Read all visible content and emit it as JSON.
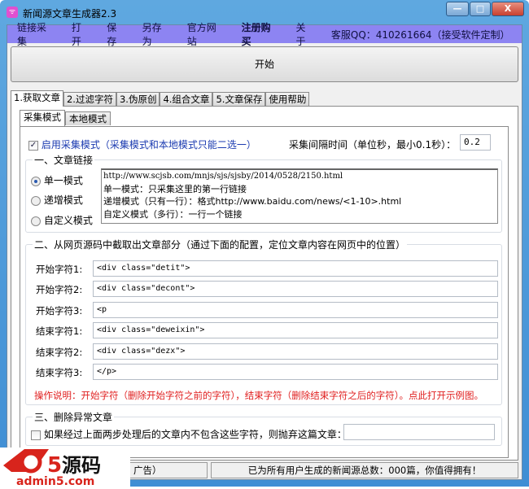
{
  "window": {
    "title": "新闻源文章生成器2.3",
    "minimize": "—",
    "maximize": "□",
    "close": "X"
  },
  "menu": [
    "链接采集",
    "打开",
    "保存",
    "另存为",
    "官方网站",
    "注册购买",
    "关于",
    "客服QQ：410261664（接受软件定制）"
  ],
  "start_label": "开始",
  "tabs": [
    "1.获取文章",
    "2.过滤字符",
    "3.伪原创",
    "4.组合文章",
    "5.文章保存",
    "使用帮助"
  ],
  "subtabs": [
    "采集模式",
    "本地模式"
  ],
  "enable_collect": {
    "label": "启用采集模式（采集模式和本地模式只能二选一）",
    "checked": true
  },
  "interval": {
    "label": "采集间隔时间（单位秒，最小0.1秒）：",
    "value": "0.2"
  },
  "group1": {
    "title": "一、文章链接",
    "modes": [
      "单一模式",
      "递增模式",
      "自定义模式"
    ],
    "selected": 0,
    "text_lines": [
      "http://www.scjsb.com/mnjs/sjs/sjsby/2014/0528/2150.html",
      "单一模式：只采集这里的第一行链接",
      "递增模式（只有一行）：格式http://www.baidu.com/news/<1-10>.html",
      "自定义模式（多行）：一行一个链接"
    ]
  },
  "group2": {
    "title": "二、从网页源码中截取出文章部分（通过下面的配置，定位文章内容在网页中的位置）",
    "fields": [
      {
        "label": "开始字符1:",
        "value": "<div class=\"detit\">"
      },
      {
        "label": "开始字符2:",
        "value": "<div class=\"decont\">"
      },
      {
        "label": "开始字符3:",
        "value": "<p"
      },
      {
        "label": "结束字符1:",
        "value": "<div class=\"deweixin\">"
      },
      {
        "label": "结束字符2:",
        "value": "<div class=\"dezx\">"
      },
      {
        "label": "结束字符3:",
        "value": "</p>"
      }
    ],
    "note": "操作说明：开始字符（删除开始字符之前的字符），结束字符（删除结束字符之后的字符）。点此打开示例图。"
  },
  "group3": {
    "title": "三、删除异常文章",
    "checkbox_label": "如果经过上面两步处理后的文章内不包含这些字符，则抛弃这篇文章：",
    "checked": false,
    "value": ""
  },
  "statusbar": {
    "left": "广告）",
    "right": "已为所有用户生成的新闻源总数：000篇，你值得拥有！"
  },
  "watermark": {
    "brand": "a5源码",
    "url": "admin5.com"
  },
  "colors": {
    "menubar": "#8d84f2",
    "note": "#e02020",
    "link": "#1a3ab0"
  }
}
